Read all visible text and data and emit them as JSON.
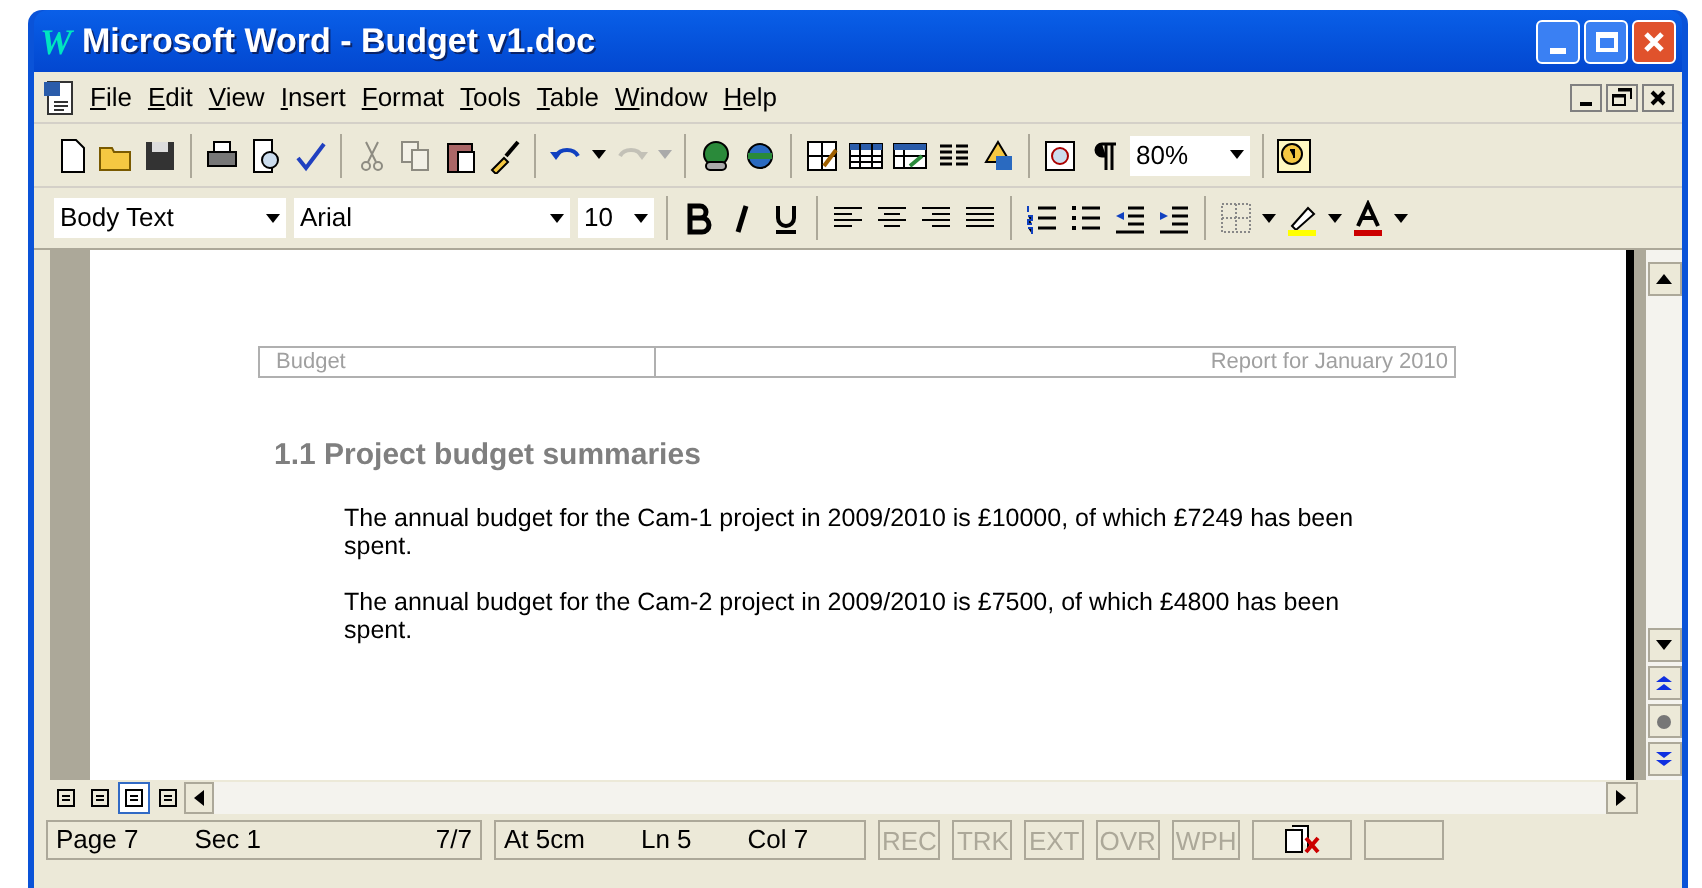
{
  "window": {
    "logo": "W",
    "title": "Microsoft Word - Budget v1.doc"
  },
  "menu": [
    "File",
    "Edit",
    "View",
    "Insert",
    "Format",
    "Tools",
    "Table",
    "Window",
    "Help"
  ],
  "formatting": {
    "style": "Body Text",
    "font": "Arial",
    "size": "10",
    "zoom": "80%"
  },
  "document": {
    "header_left": "Budget",
    "header_right": "Report for January 2010",
    "heading": "1.1 Project budget summaries",
    "paragraphs": [
      "The annual budget for the Cam-1 project in 2009/2010 is £10000, of which £7249 has been spent.",
      "The annual budget for the Cam-2 project in 2009/2010 is £7500, of which £4800 has been spent."
    ]
  },
  "view_buttons": [
    {
      "selected": false
    },
    {
      "selected": false
    },
    {
      "selected": true
    },
    {
      "selected": false
    }
  ],
  "status_bar": {
    "page": "Page 7",
    "section": "Sec 1",
    "pages": "7/7",
    "at": "At 5cm",
    "line": "Ln 5",
    "column": "Col 7",
    "modes": [
      {
        "label": "REC",
        "disabled": true
      },
      {
        "label": "TRK",
        "disabled": true
      },
      {
        "label": "EXT",
        "disabled": true
      },
      {
        "label": "OVR",
        "disabled": true
      },
      {
        "label": "WPH",
        "disabled": true
      }
    ]
  }
}
